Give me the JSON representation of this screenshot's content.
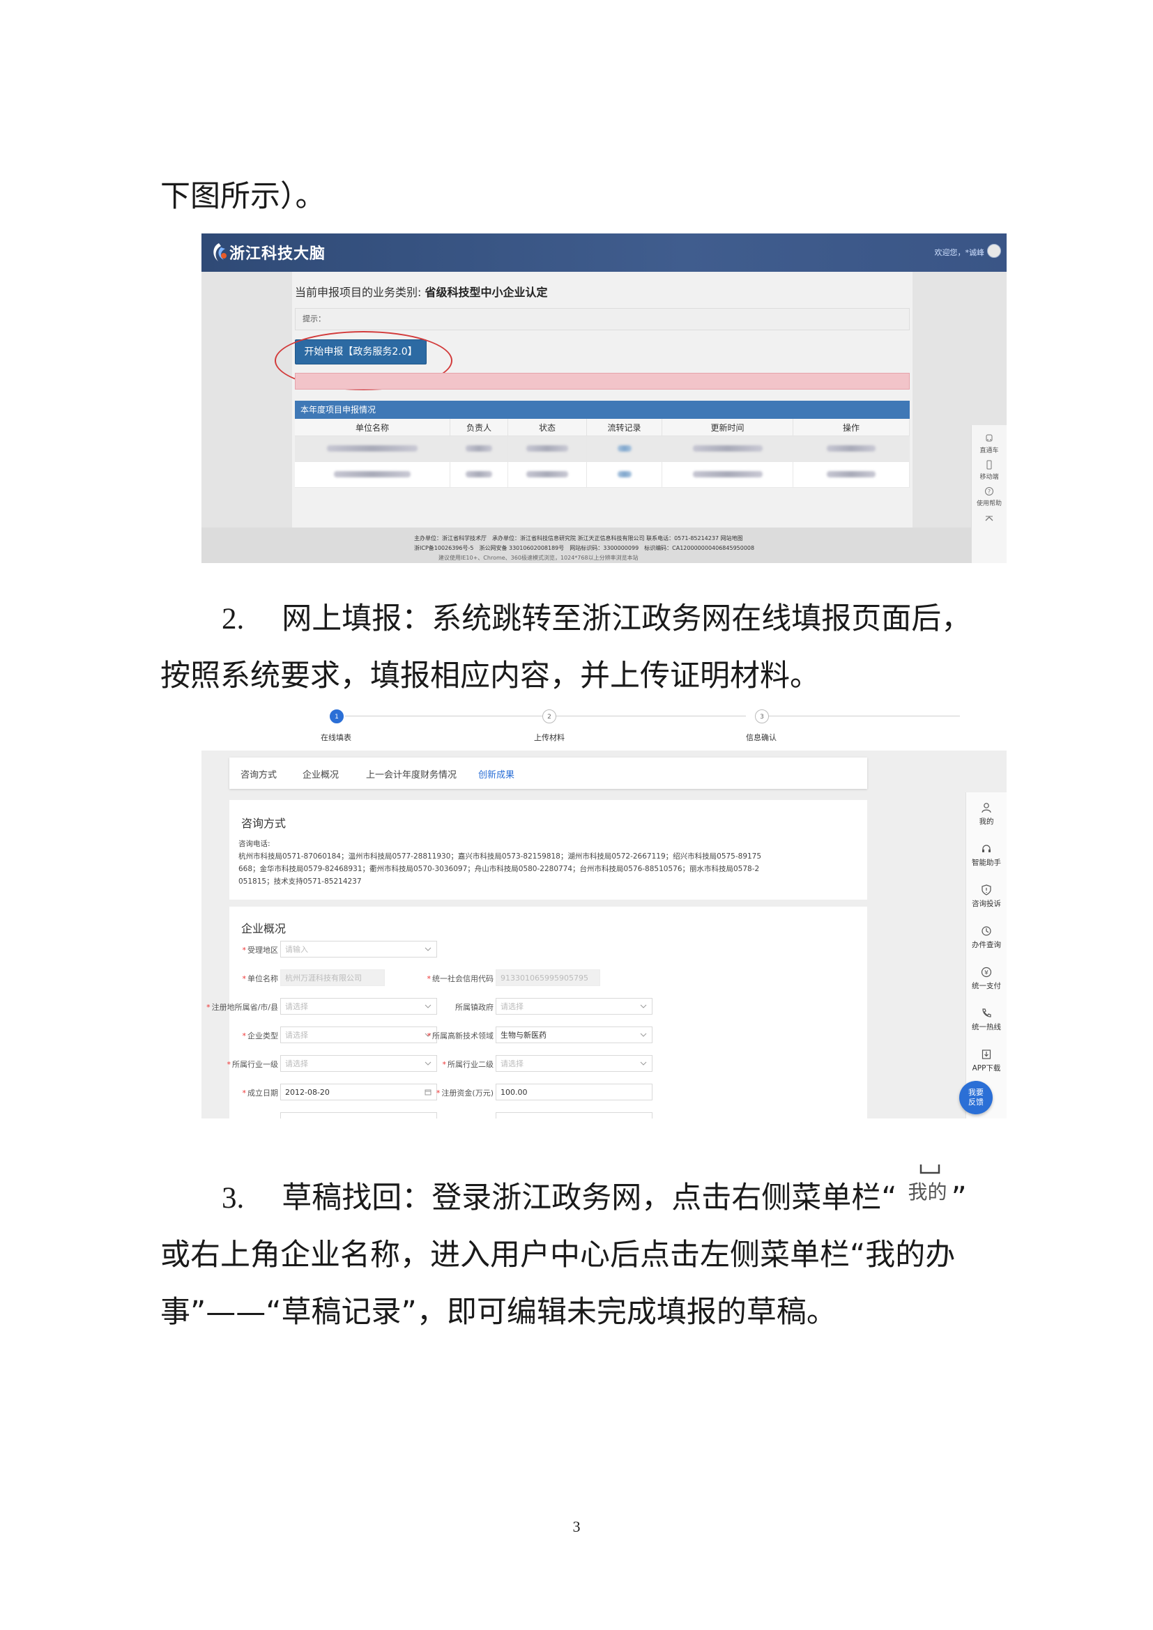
{
  "doc": {
    "intro_line": "下图所示）。",
    "step2": {
      "num": "2.",
      "line1": "网上填报：系统跳转至浙江政务网在线填报页面后，",
      "line2": "按照系统要求，填报相应内容，并上传证明材料。"
    },
    "step3": {
      "num": "3.",
      "line1_pre": "草稿找回：登录浙江政务网，点击右侧菜单栏“",
      "line1_icon_text": "我的",
      "line1_post": "”",
      "line2": "或右上角企业名称，进入用户中心后点击左侧菜单栏“我的办",
      "line3": "事”——“草稿记录”，即可编辑未完成填报的草稿。"
    },
    "page_number": "3"
  },
  "shot1": {
    "logo": "浙江科技大脑",
    "welcome": "欢迎您，*诚峰",
    "business_label": "当前申报项目的业务类别:",
    "business_value": "省级科技型中小企业认定",
    "tip_label": "提示：",
    "start_button": "开始申报【政务服务2.0】",
    "table_title": "本年度项目申报情况",
    "columns": [
      "单位名称",
      "负责人",
      "状态",
      "流转记录",
      "更新时间",
      "操作"
    ],
    "footer_line1": "主办单位：浙江省科学技术厅　承办单位：浙江省科技信息研究院 浙江天正信息科技有限公司 联系电话：0571-85214237 网站地图",
    "footer_line2": "浙ICP备10026396号-5　浙公网安备 33010602008189号　网站标识码：3300000099　标识编码：CA120000000406845950008",
    "footer_line3": "建议使用IE10+、Chrome、360极速模式浏览，1024*768以上分辨率浏览本站",
    "side": [
      {
        "icon": "train-icon",
        "label": "直通车"
      },
      {
        "icon": "mobile-icon",
        "label": "移动端"
      },
      {
        "icon": "help-icon",
        "label": "使用帮助"
      }
    ]
  },
  "shot2": {
    "steps": [
      {
        "num": "1",
        "label": "在线填表"
      },
      {
        "num": "2",
        "label": "上传材料"
      },
      {
        "num": "3",
        "label": "信息确认"
      }
    ],
    "tabs": [
      "咨询方式",
      "企业概况",
      "上一会计年度财务情况",
      "创新成果"
    ],
    "consult_title": "咨询方式",
    "consult_label": "咨询电话:",
    "consult_line1": "杭州市科技局0571-87060184；温州市科技局0577-28811930；嘉兴市科技局0573-82159818；湖州市科技局0572-2667119；绍兴市科技局0575-89175",
    "consult_line2": "668；金华市科技局0579-82468931；衢州市科技局0570-3036097；舟山市科技局0580-2280774；台州市科技局0576-88510576；丽水市科技局0578-2",
    "consult_line3": "051815；技术支持0571-85214237",
    "company_title": "企业概况",
    "fields": {
      "area_label": "受理地区",
      "area_ph": "请输入",
      "name_label": "单位名称",
      "name_value": "杭州万涯科技有限公司",
      "credit_label": "统一社会信用代码",
      "credit_value": "913301065995905795",
      "reg_label": "注册地所属省/市/县",
      "reg_ph": "请选择",
      "town_label": "所属镇政府",
      "town_ph": "请选择",
      "type_label": "企业类型",
      "type_ph": "请选择",
      "hitech_label": "所属高新技术领域",
      "hitech_value": "生物与新医药",
      "ind1_label": "所属行业一级",
      "ind1_ph": "请选择",
      "ind2_label": "所属行业二级",
      "ind2_ph": "请选择",
      "date_label": "成立日期",
      "date_value": "2012-08-20",
      "capital_label": "注册资金(万元)",
      "capital_value": "100.00"
    },
    "sidebar": [
      {
        "icon": "user-icon",
        "label": "我的"
      },
      {
        "icon": "headset-icon",
        "label": "智能助手"
      },
      {
        "icon": "shield-icon",
        "label": "咨询投诉"
      },
      {
        "icon": "history-icon",
        "label": "办件查询"
      },
      {
        "icon": "yen-icon",
        "label": "统一支付"
      },
      {
        "icon": "phone-icon",
        "label": "统一热线"
      },
      {
        "icon": "download-icon",
        "label": "APP下载"
      }
    ],
    "feedback_line1": "我要",
    "feedback_line2": "反馈"
  },
  "colors": {
    "accent_blue": "#2b6fd6",
    "header_navy": "#2f4a76",
    "table_header_blue": "#3f78b6",
    "annotation_red": "#d23a3a"
  }
}
